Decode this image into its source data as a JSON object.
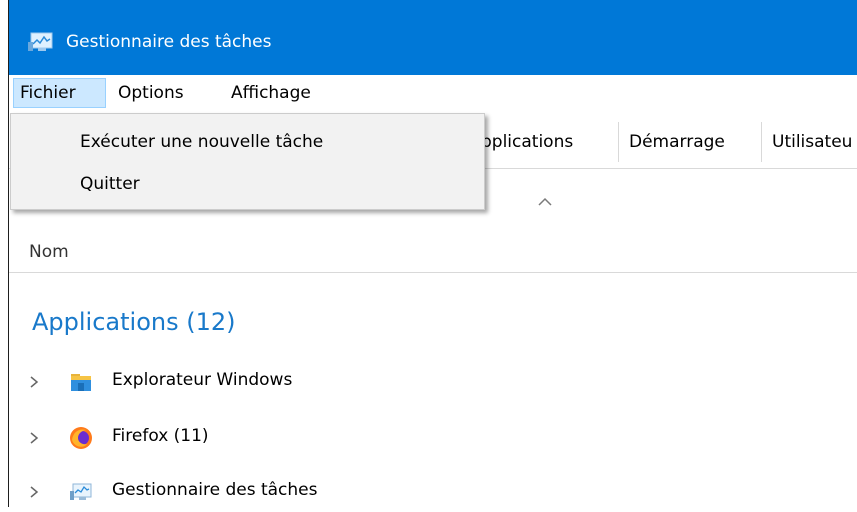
{
  "window": {
    "title": "Gestionnaire des tâches",
    "titlebar_color": "#0078d7"
  },
  "menubar": {
    "items": [
      {
        "label": "Fichier",
        "active": true
      },
      {
        "label": "Options"
      },
      {
        "label": "Affichage"
      }
    ]
  },
  "file_menu": {
    "items": [
      {
        "label": "Exécuter une nouvelle tâche"
      },
      {
        "label": "Quitter"
      }
    ]
  },
  "tabs": [
    {
      "label": "pplications"
    },
    {
      "label": "Démarrage"
    },
    {
      "label": "Utilisateu"
    }
  ],
  "column_header": {
    "name": "Nom"
  },
  "group": {
    "title": "Applications (12)",
    "title_color": "#1979ca",
    "items": [
      {
        "label": "Explorateur Windows",
        "icon": "folder-icon"
      },
      {
        "label": "Firefox (11)",
        "icon": "firefox-icon"
      },
      {
        "label": "Gestionnaire des tâches",
        "icon": "task-manager-icon"
      }
    ]
  }
}
